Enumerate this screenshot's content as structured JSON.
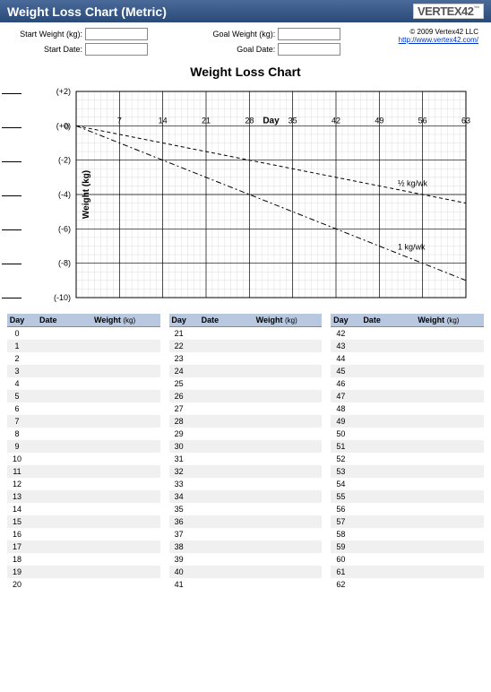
{
  "header": {
    "title": "Weight Loss Chart (Metric)",
    "logo_text": "VERTEX42"
  },
  "meta": {
    "start_weight_label": "Start Weight (kg):",
    "start_date_label": "Start Date:",
    "goal_weight_label": "Goal Weight (kg):",
    "goal_date_label": "Goal Date:",
    "start_weight_value": "",
    "start_date_value": "",
    "goal_weight_value": "",
    "goal_date_value": "",
    "copyright": "© 2009 Vertex42 LLC",
    "link_text": "http://www.vertex42.com/"
  },
  "chart_data": {
    "type": "line",
    "title": "Weight Loss Chart",
    "xlabel": "Day",
    "ylabel": "Weight  (kg)",
    "x_ticks": [
      0,
      7,
      14,
      21,
      28,
      35,
      42,
      49,
      56,
      63
    ],
    "y_ticks": [
      "(+2)",
      "(+0)",
      "(-2)",
      "(-4)",
      "(-6)",
      "(-8)",
      "(-10)"
    ],
    "xlim": [
      0,
      63
    ],
    "ylim": [
      -10,
      2
    ],
    "series": [
      {
        "name": "½ kg/wk",
        "x": [
          0,
          63
        ],
        "y": [
          0,
          -4.5
        ],
        "style": "dashed"
      },
      {
        "name": "1 kg/wk",
        "x": [
          0,
          63
        ],
        "y": [
          0,
          -9
        ],
        "style": "dashdot"
      }
    ]
  },
  "log": {
    "headers": {
      "day": "Day",
      "date": "Date",
      "weight": "Weight",
      "weight_unit": "(kg)"
    },
    "columns": [
      {
        "start": 0,
        "end": 20
      },
      {
        "start": 21,
        "end": 41
      },
      {
        "start": 42,
        "end": 62
      }
    ]
  }
}
